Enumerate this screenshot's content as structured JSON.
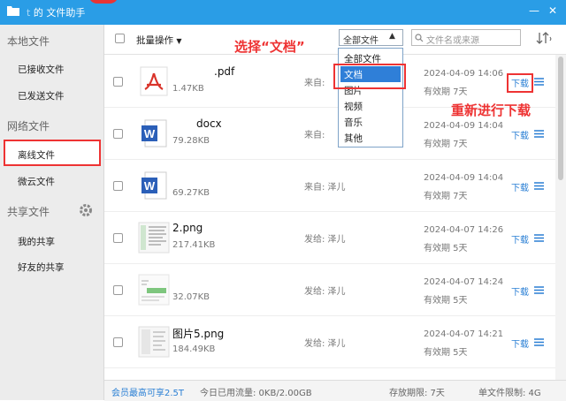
{
  "window": {
    "title": "的 文件助手",
    "title_prefix": "t"
  },
  "sidebar": {
    "local_title": "本地文件",
    "received": "已接收文件",
    "sent": "已发送文件",
    "network_title": "网络文件",
    "offline": "离线文件",
    "weiyun": "微云文件",
    "share_title": "共享文件",
    "my_share": "我的共享",
    "friend_share": "好友的共享"
  },
  "toolbar": {
    "bulk_label": "批量操作",
    "filter_value": "全部文件",
    "search_placeholder": "文件名或来源"
  },
  "annotations": {
    "select_doc": "选择“文档”",
    "redownload": "重新进行下载"
  },
  "dropdown": {
    "options": [
      "全部文件",
      "文档",
      "图片",
      "视频",
      "音乐",
      "其他"
    ]
  },
  "files": [
    {
      "name": ".pdf",
      "size": "1.47KB",
      "from": "来自:",
      "date": "2024-04-09 14:06",
      "valid": "有效期 7天",
      "action": "下载",
      "type": "pdf"
    },
    {
      "name": "docx",
      "size": "79.28KB",
      "from": "来自:",
      "date": "2024-04-09 14:04",
      "valid": "有效期 7天",
      "action": "下载",
      "type": "word"
    },
    {
      "name": "",
      "size": "69.27KB",
      "from": "来自: 泽儿",
      "date": "2024-04-09 14:04",
      "valid": "有效期 7天",
      "action": "下载",
      "type": "word"
    },
    {
      "name": "2.png",
      "size": "217.41KB",
      "from": "发给: 泽儿",
      "date": "2024-04-07 14:26",
      "valid": "有效期 5天",
      "action": "下载",
      "type": "image"
    },
    {
      "name": "",
      "size": "32.07KB",
      "from": "发给: 泽儿",
      "date": "2024-04-07 14:24",
      "valid": "有效期 5天",
      "action": "下载",
      "type": "image"
    },
    {
      "name": "图片5.png",
      "size": "184.49KB",
      "from": "发给: 泽儿",
      "date": "2024-04-07 14:21",
      "valid": "有效期 5天",
      "action": "下载",
      "type": "image"
    }
  ],
  "footer": {
    "vip": "会员最高可享2.5T",
    "traffic": "今日已用流量: 0KB/2.00GB",
    "period": "存放期限: 7天",
    "limit": "单文件限制: 4G"
  },
  "colors": {
    "titlebar": "#2a9de6",
    "accent": "#2a7fd4",
    "annotation": "#e33434"
  }
}
